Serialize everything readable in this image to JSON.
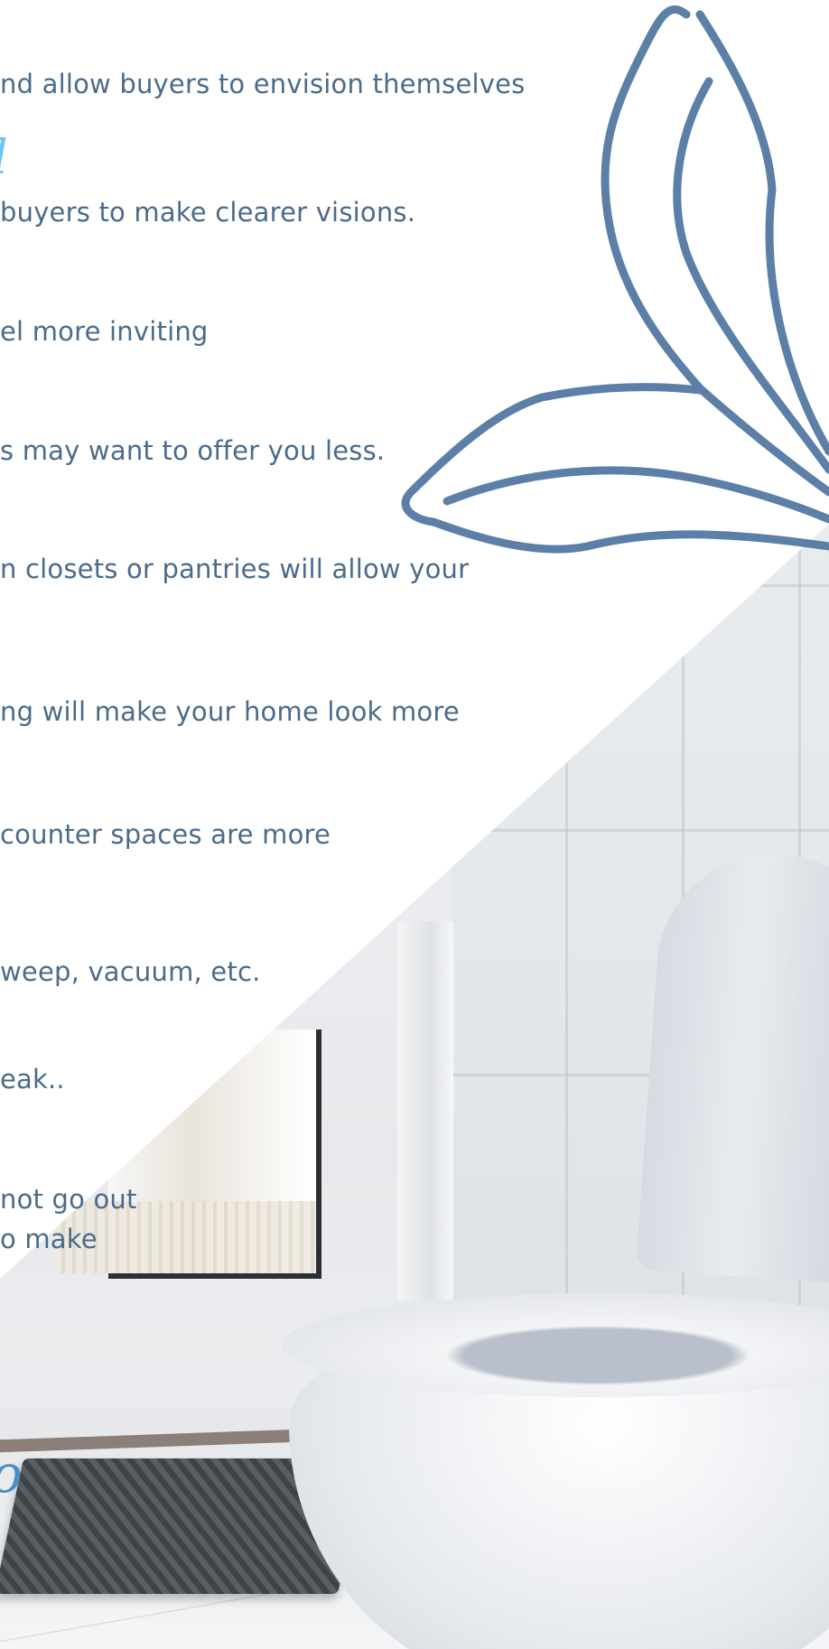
{
  "text_lines": [
    "nd allow buyers to envision themselves",
    "buyers to make clearer visions.",
    "el more inviting",
    "s may want to offer you less.",
    "n closets or pantries will allow your",
    "ng will make your home look more",
    "counter spaces are more",
    "weep, vacuum, etc.",
    "eak..",
    "not go out",
    "o make"
  ],
  "script_fragment_top": "l",
  "script_fragment_bottom": "o",
  "colors": {
    "body_text": "#4a6b8a",
    "script_text": "#6ec3ef",
    "leaf_stroke": "#5b7fa6"
  },
  "icons": {
    "decoration": "leaf-outline-icon",
    "photo": "bathroom-toilet-photo"
  }
}
